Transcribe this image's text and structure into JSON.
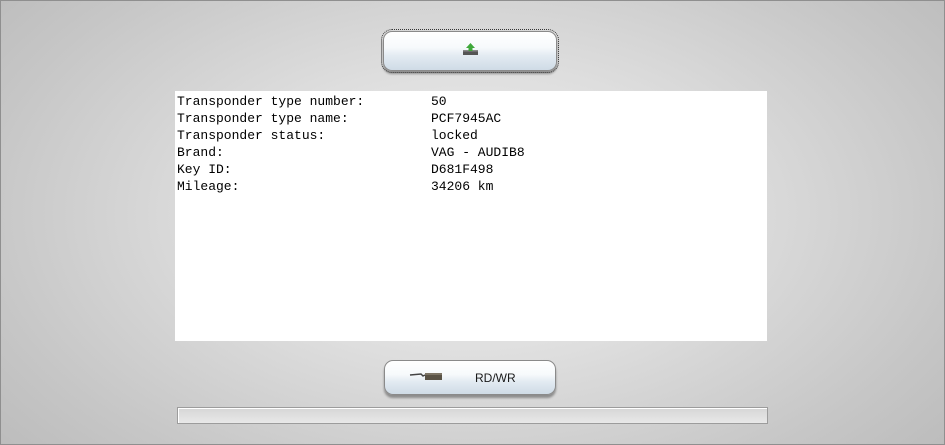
{
  "toolbar": {
    "top_button_icon": "upload-arrow-icon",
    "bottom_button_icon": "key-reader-icon",
    "rdwr_label": "RD/WR"
  },
  "transponder_info": [
    {
      "label": "Transponder type number:",
      "value": "50"
    },
    {
      "label": "Transponder type name:",
      "value": "PCF7945AC"
    },
    {
      "label": "Transponder status:",
      "value": "locked"
    },
    {
      "label": "Brand:",
      "value": "VAG - AUDIB8"
    },
    {
      "label": "Key ID:",
      "value": "D681F498"
    },
    {
      "label": "Mileage:",
      "value": "34206 km"
    }
  ],
  "progress": {
    "fraction": 0.0
  },
  "colors": {
    "accent_green": "#3fa83a",
    "panel_bg": "#ffffff"
  }
}
